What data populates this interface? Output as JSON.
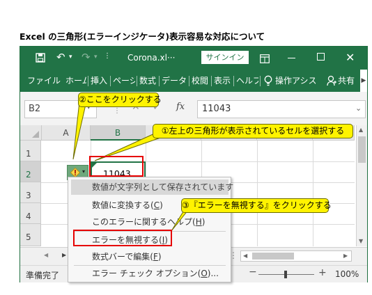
{
  "page_title": "Excel の三角形(エラーインジケータ)表示容易な対応について",
  "titlebar": {
    "filename": "Corona.xl···",
    "signin_label": "サインイン"
  },
  "ribbon": {
    "tabs": [
      "ファイル",
      "ホーム",
      "挿入",
      "ページ",
      "数式",
      "データ",
      "校閲",
      "表示",
      "ヘルプ"
    ],
    "search_label": "操作アシス",
    "share_label": "共有"
  },
  "formula_bar": {
    "name_box": "B2",
    "fx_label": "fx",
    "formula_value": "11043"
  },
  "grid": {
    "columns": [
      "A",
      "B"
    ],
    "rows": [
      "1",
      "2",
      "3",
      "4",
      "5"
    ],
    "cell_b2_value": "11043"
  },
  "context_menu": {
    "items": [
      {
        "text": "数値が文字列として保存されています",
        "shortcut": ""
      },
      {
        "text": "数値に変換する(",
        "shortcut": "C",
        "suffix": ")"
      },
      {
        "text": "このエラーに関するヘルプ(",
        "shortcut": "H",
        "suffix": ")"
      },
      {
        "text": "エラーを無視する(",
        "shortcut": "I",
        "suffix": ")"
      },
      {
        "text": "数式バーで編集(",
        "shortcut": "F",
        "suffix": ")"
      },
      {
        "text": "エラー チェック オプション(",
        "shortcut": "O",
        "suffix": ")..."
      }
    ]
  },
  "callouts": {
    "step1": "①左上の三角形が表示されているセルを選択する",
    "step2": "②ここをクリックする",
    "step3": "③『エラーを無視する』をクリックする"
  },
  "statusbar": {
    "status_text": "準備完了",
    "zoom_label": "100%"
  },
  "colors": {
    "excel_green": "#217346",
    "callout_yellow": "#fff300",
    "highlight_red": "#e60000"
  }
}
